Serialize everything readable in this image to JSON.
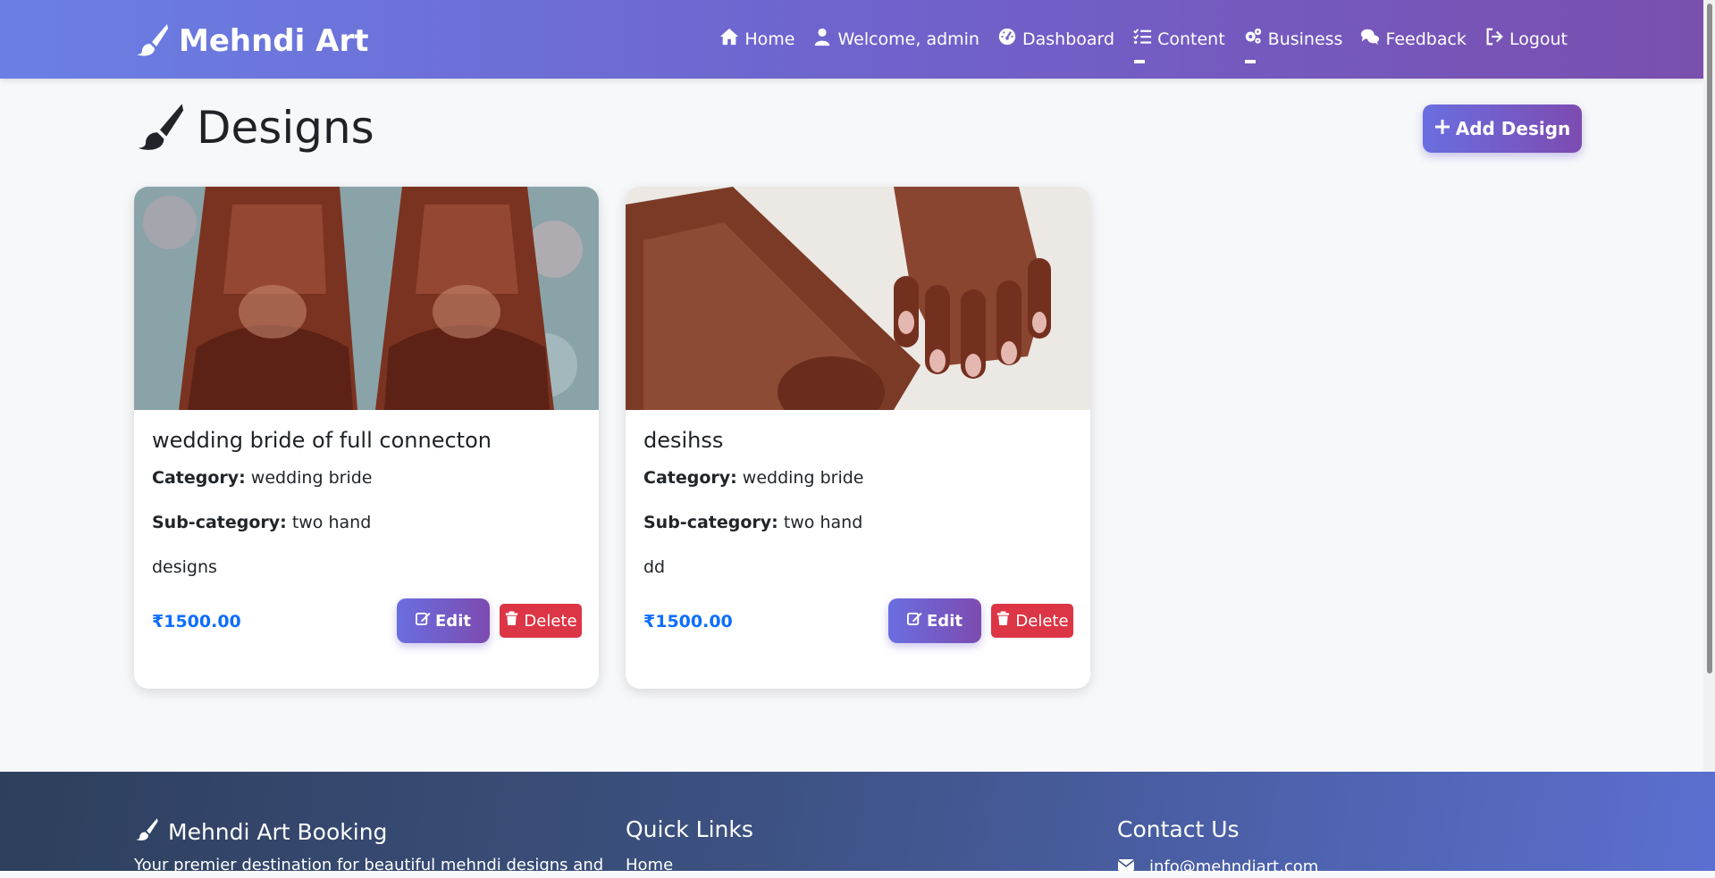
{
  "navbar": {
    "brand": "Mehndi Art",
    "links": [
      {
        "label": "Home",
        "icon": "home-icon"
      },
      {
        "label": "Welcome, admin",
        "icon": "user-icon"
      },
      {
        "label": "Dashboard",
        "icon": "gauge-icon"
      },
      {
        "label": "Content",
        "icon": "list-check-icon"
      },
      {
        "label": "Business",
        "icon": "gears-icon"
      },
      {
        "label": "Feedback",
        "icon": "comments-icon"
      },
      {
        "label": "Logout",
        "icon": "logout-icon"
      }
    ]
  },
  "page": {
    "title": "Designs",
    "add_button": "Add Design"
  },
  "designs": [
    {
      "title": "wedding bride of full connecton",
      "category_label": "Category:",
      "category": "wedding bride",
      "subcategory_label": "Sub-category:",
      "subcategory": "two hand",
      "description": "designs",
      "price": "₹1500.00",
      "edit_label": "Edit",
      "delete_label": "Delete"
    },
    {
      "title": "desihss",
      "category_label": "Category:",
      "category": "wedding bride",
      "subcategory_label": "Sub-category:",
      "subcategory": "two hand",
      "description": "dd",
      "price": "₹1500.00",
      "edit_label": "Edit",
      "delete_label": "Delete"
    }
  ],
  "footer": {
    "brand_heading": "Mehndi Art Booking",
    "brand_text": "Your premier destination for beautiful mehndi designs and",
    "quick_links_heading": "Quick Links",
    "quick_links": [
      "Home"
    ],
    "contact_heading": "Contact Us",
    "email": "info@mehndiart.com"
  },
  "colors": {
    "nav_gradient_start": "#6a7fe4",
    "nav_gradient_end": "#7a4fae",
    "price": "#0d6efd",
    "delete": "#dc3545"
  }
}
